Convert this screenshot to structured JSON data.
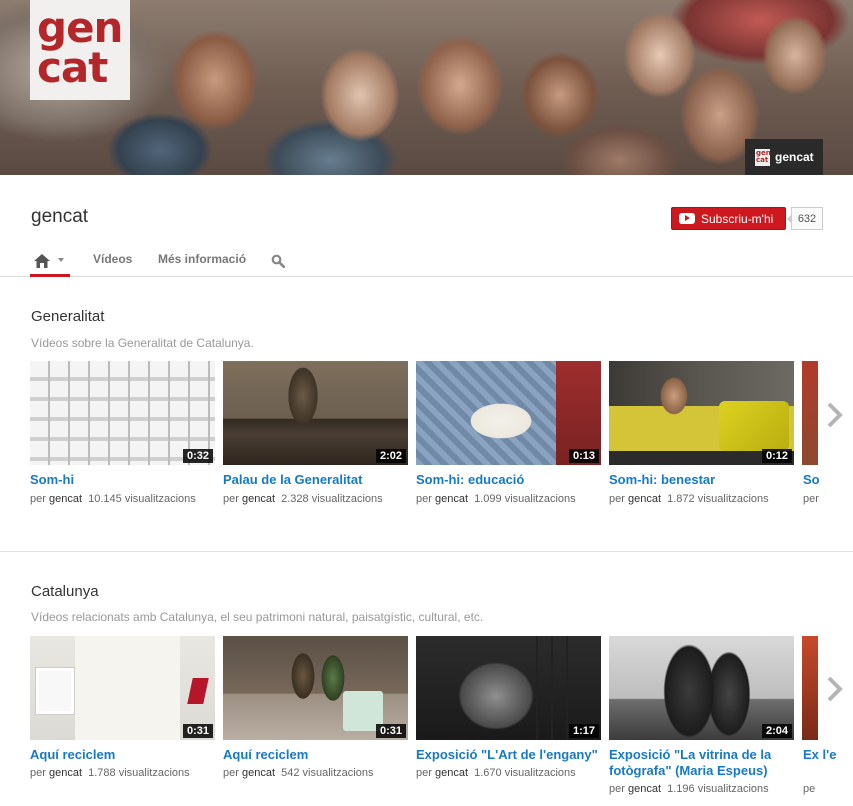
{
  "banner": {
    "logo_line1": "gen",
    "logo_line2": "cat",
    "badge_logo_line1": "gen",
    "badge_logo_line2": "cat",
    "badge_label": "gencat"
  },
  "channel": {
    "name": "gencat",
    "subscribe_label": "Subscriu-m'hi",
    "subscriber_count": "632"
  },
  "tabs": {
    "videos": "Vídeos",
    "info": "Més informació"
  },
  "colors": {
    "accent": "#cc181e",
    "link": "#167ac6"
  },
  "sections": [
    {
      "title": "Generalitat",
      "description": "Vídeos sobre la Generalitat de Catalunya.",
      "videos": [
        {
          "title": "Som-hi",
          "duration": "0:32",
          "by": "per",
          "author": "gencat",
          "views": "10.145 visualitzacions"
        },
        {
          "title": "Palau de la Generalitat",
          "duration": "2:02",
          "by": "per",
          "author": "gencat",
          "views": "2.328 visualitzacions"
        },
        {
          "title": "Som-hi: educació",
          "duration": "0:13",
          "by": "per",
          "author": "gencat",
          "views": "1.099 visualitzacions"
        },
        {
          "title": "Som-hi: benestar",
          "duration": "0:12",
          "by": "per",
          "author": "gencat",
          "views": "1.872 visualitzacions"
        },
        {
          "title": "So",
          "by": "per"
        }
      ]
    },
    {
      "title": "Catalunya",
      "description": "Vídeos relacionats amb Catalunya, el seu patrimoni natural, paisatgístic, cultural, etc.",
      "videos": [
        {
          "title": "Aquí reciclem",
          "duration": "0:31",
          "by": "per",
          "author": "gencat",
          "views": "1.788 visualitzacions"
        },
        {
          "title": "Aquí reciclem",
          "duration": "0:31",
          "by": "per",
          "author": "gencat",
          "views": "542 visualitzacions"
        },
        {
          "title": "Exposició \"L'Art de l'engany\"",
          "duration": "1:17",
          "by": "per",
          "author": "gencat",
          "views": "1.670 visualitzacions"
        },
        {
          "title": "Exposició \"La vitrina de la fotògrafa\" (Maria Espeus)",
          "duration": "2:04",
          "by": "per",
          "author": "gencat",
          "views": "1.196 visualitzacions"
        },
        {
          "title": "Ex l'e",
          "by": "pe"
        }
      ]
    }
  ]
}
